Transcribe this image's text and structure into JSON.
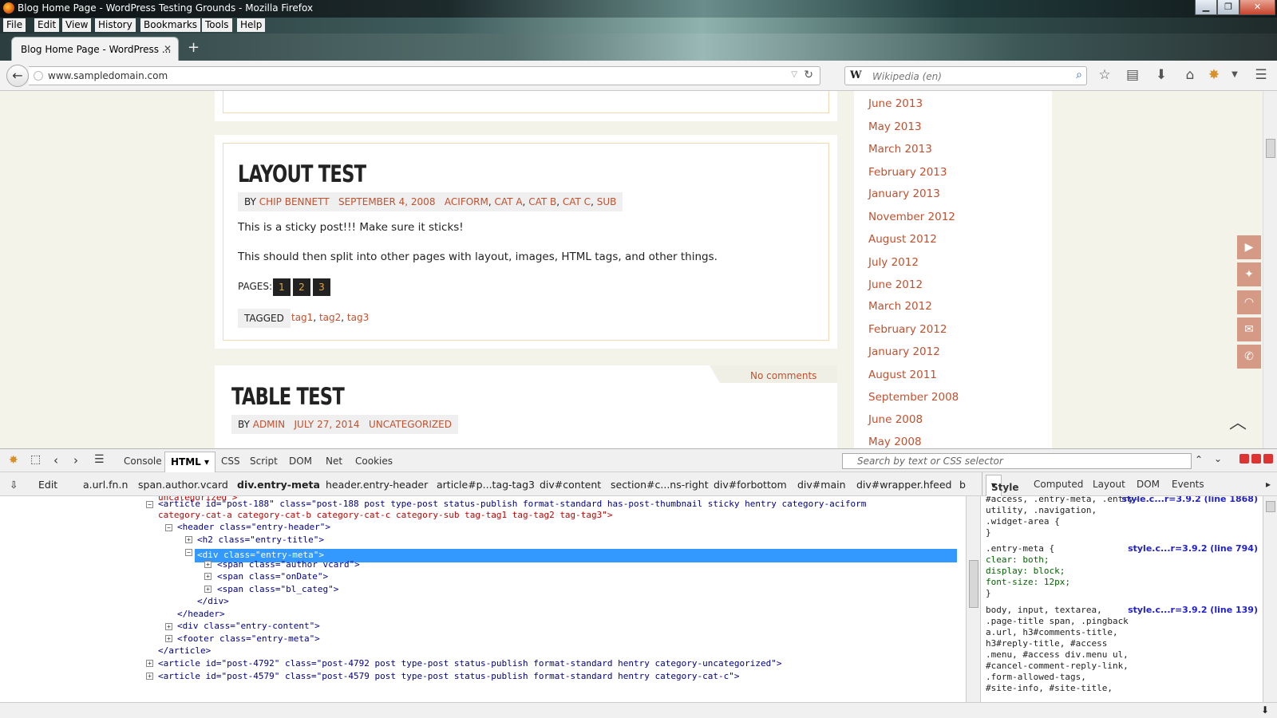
{
  "window": {
    "title": "Blog Home Page - WordPress Testing Grounds - Mozilla Firefox"
  },
  "menu": {
    "file": "File",
    "edit": "Edit",
    "view": "View",
    "history": "History",
    "bookmarks": "Bookmarks",
    "tools": "Tools",
    "help": "Help"
  },
  "tab": {
    "label": "Blog Home Page - WordPress ...",
    "close": "✕",
    "new": "+"
  },
  "nav": {
    "url": "www.sampledomain.com",
    "search_placeholder": "Wikipedia (en)",
    "search_engine": "W"
  },
  "post1": {
    "title": "LAYOUT TEST",
    "by": "BY",
    "author": "CHIP BENNETT",
    "date": "SEPTEMBER 4, 2008",
    "categories": [
      "ACIFORM",
      "CAT A",
      "CAT B",
      "CAT C",
      "SUB"
    ],
    "p1": "This is a sticky post!!! Make sure it sticks!",
    "p2": "This should then split into other pages with layout, images, HTML tags, and other things.",
    "pages_label": "PAGES:",
    "pages": [
      "1",
      "2",
      "3"
    ],
    "tagged_label": "TAGGED",
    "tags": [
      "tag1",
      "tag2",
      "tag3"
    ]
  },
  "post2": {
    "comments": "No comments",
    "title": "TABLE TEST",
    "by": "BY",
    "author": "ADMIN",
    "date": "JULY 27, 2014",
    "category": "UNCATEGORIZED"
  },
  "archives": [
    "June 2013",
    "May 2013",
    "March 2013",
    "February 2013",
    "January 2013",
    "November 2012",
    "August 2012",
    "July 2012",
    "June 2012",
    "March 2012",
    "February 2012",
    "January 2012",
    "August 2011",
    "September 2008",
    "June 2008",
    "May 2008"
  ],
  "social": [
    "youtube-icon",
    "twitter-icon",
    "rss-icon",
    "mail-icon",
    "phone-icon"
  ],
  "firebug": {
    "tabs": [
      "Console",
      "HTML",
      "CSS",
      "Script",
      "DOM",
      "Net",
      "Cookies"
    ],
    "search_placeholder": "Search by text or CSS selector",
    "edit": "Edit",
    "breadcrumbs": [
      "a.url.fn.n",
      "span.author.vcard",
      "div.entry-meta",
      "header.entry-header",
      "article#p...tag-tag3",
      "div#content",
      "section#c...ns-right",
      "div#forbottom",
      "div#main",
      "div#wrapper.hfeed",
      "b"
    ],
    "side_tabs": [
      "Style",
      "Computed",
      "Layout",
      "DOM",
      "Events"
    ],
    "html_lines": [
      "uncategorized\">",
      "<article id=\"post-188\" class=\"post-188 post type-post status-publish format-standard has-post-thumbnail sticky hentry category-aciform",
      "category-cat-a category-cat-b category-cat-c category-sub tag-tag1 tag-tag2 tag-tag3\">",
      "<header class=\"entry-header\">",
      "<h2 class=\"entry-title\">",
      "<div class=\"entry-meta\">",
      "<span class=\"author vcard\">",
      "<span class=\"onDate\">",
      "<span class=\"bl_categ\">",
      "</div>",
      "</header>",
      "<div class=\"entry-content\">",
      "<footer class=\"entry-meta\">",
      "</article>",
      "<article id=\"post-4792\" class=\"post-4792 post type-post status-publish format-standard hentry category-uncategorized\">",
      "<article id=\"post-4579\" class=\"post-4579 post type-post status-publish format-standard hentry category-cat-c\">"
    ],
    "style_rules": [
      {
        "lines": [
          "#access, .entry-meta, .entry-",
          "utility, .navigation,",
          ".widget-area {",
          "}"
        ],
        "source": "style.c...r=3.9.2 (line 1868)"
      },
      {
        "lines": [
          ".entry-meta {",
          "    clear: both;",
          "    display: block;",
          "    font-size: 12px;",
          "}"
        ],
        "source": "style.c...r=3.9.2 (line 794)"
      },
      {
        "lines": [
          "body, input, textarea,",
          ".page-title span, .pingback",
          "a.url, h3#comments-title,",
          "h3#reply-title, #access",
          ".menu, #access div.menu ul,",
          "#cancel-comment-reply-link,",
          ".form-allowed-tags,",
          "#site-info, #site-title,"
        ],
        "source": "style.c...r=3.9.2 (line 139)"
      }
    ]
  },
  "colors": {
    "link": "#c2502e",
    "selection": "#3399ff",
    "page_bg": "#f4f3ea"
  }
}
